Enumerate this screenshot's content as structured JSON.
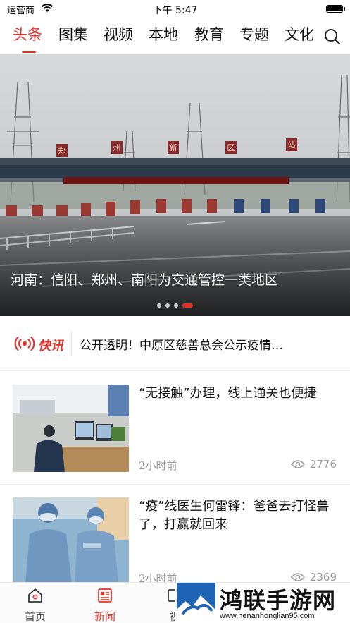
{
  "status_bar": {
    "carrier": "运营商",
    "time": "下午 5:47"
  },
  "tabs": [
    {
      "label": "头条"
    },
    {
      "label": "图集"
    },
    {
      "label": "视频"
    },
    {
      "label": "本地"
    },
    {
      "label": "教育"
    },
    {
      "label": "专题"
    },
    {
      "label": "文化"
    }
  ],
  "hero": {
    "caption": "河南：信阳、郑州、南阳为交通管控一类地区",
    "gate_sign_chars": [
      "郑",
      "州",
      "新",
      "区",
      "站"
    ],
    "slide_count": 4,
    "active_slide": 4
  },
  "flash": {
    "logo_label": "快讯",
    "headline": "公开透明！中原区慈善总会公示疫情…"
  },
  "news": [
    {
      "title": "“无接触”办理，线上通关也便捷",
      "time": "2小时前",
      "views": "2776"
    },
    {
      "title": "“疫”线医生何雷锋：爸爸去打怪兽了，打赢就回来",
      "time": "2小时前",
      "views": "2369"
    }
  ],
  "tabbar": [
    {
      "label": "首页"
    },
    {
      "label": "新闻"
    },
    {
      "label": "视"
    }
  ],
  "watermark": {
    "title": "鸿联手游网",
    "url": "www.henanhonglian95.com"
  },
  "colors": {
    "accent": "#e2342c",
    "muted": "#999999"
  }
}
